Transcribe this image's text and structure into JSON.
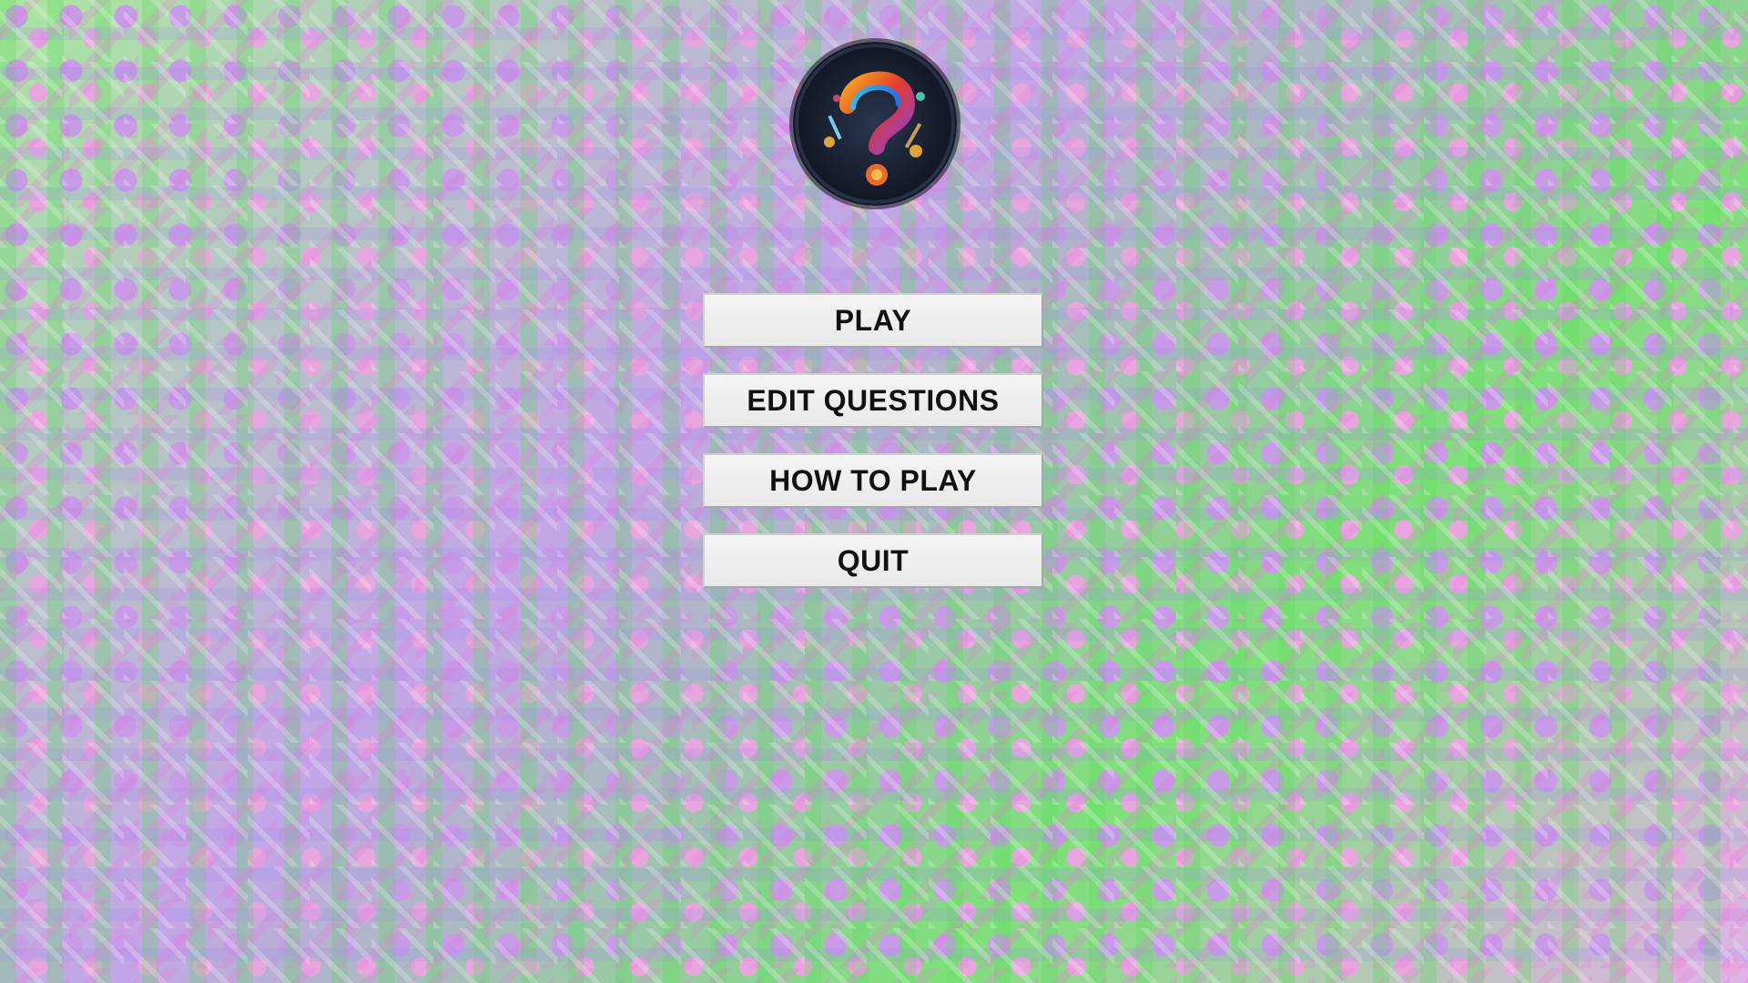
{
  "logo": {
    "icon": "question-mark-art-logo",
    "colors": [
      "#e63b2e",
      "#f5a623",
      "#3fb7d9",
      "#8a3fd1"
    ]
  },
  "menu": {
    "play_label": "PLAY",
    "edit_questions_label": "EDIT QUESTIONS",
    "how_to_play_label": "HOW TO PLAY",
    "quit_label": "QUIT"
  }
}
